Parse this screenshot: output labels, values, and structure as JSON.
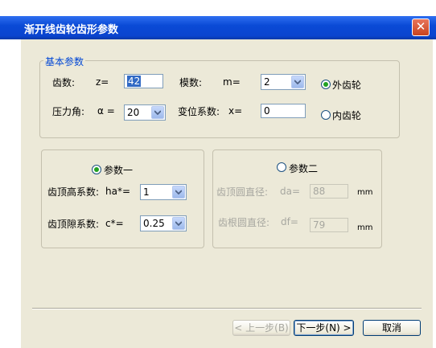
{
  "window": {
    "title": "渐开线齿轮齿形参数",
    "close_glyph": "✕"
  },
  "basic": {
    "legend": "基本参数",
    "teeth_label": "齿数:",
    "z_label": "z=",
    "z_value": "42",
    "module_label": "模数:",
    "m_label": "m=",
    "m_value": "2",
    "pressure_label": "压力角:",
    "alpha_label": "α =",
    "alpha_value": "20",
    "shift_label": "变位系数:",
    "x_label": "x=",
    "x_value": "0",
    "external_label": "外齿轮",
    "internal_label": "内齿轮",
    "external_selected": true
  },
  "param1": {
    "label": "参数一",
    "selected": true,
    "ha_label": "齿顶高系数:",
    "ha_sym": "ha*=",
    "ha_value": "1",
    "c_label": "齿顶隙系数:",
    "c_sym": "c*=",
    "c_value": "0.25"
  },
  "param2": {
    "label": "参数二",
    "selected": false,
    "da_label": "齿顶圆直径:",
    "da_sym": "da=",
    "da_value": "88",
    "da_unit": "mm",
    "df_label": "齿根圆直径:",
    "df_sym": "df=",
    "df_value": "79",
    "df_unit": "mm"
  },
  "buttons": {
    "prev": "< 上一步(B)",
    "next": "下一步(N) >",
    "cancel": "取消"
  },
  "colors": {
    "titlebar": "#0a4ad6",
    "dialog_bg": "#ece9d8",
    "radio_dot": "#21a121"
  }
}
